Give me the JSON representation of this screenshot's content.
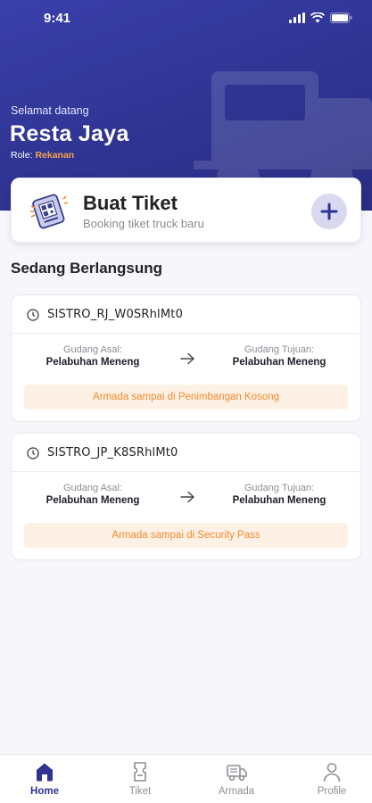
{
  "status_bar": {
    "time": "9:41"
  },
  "header": {
    "welcome": "Selamat datang",
    "user_name": "Resta Jaya",
    "role_label": "Role:",
    "role_value": "Rekanan"
  },
  "create_ticket": {
    "title": "Buat Tiket",
    "subtitle": "Booking tiket truck baru",
    "button_icon": "plus-icon"
  },
  "section": {
    "title": "Sedang Berlangsung"
  },
  "trips": [
    {
      "code": "SISTRO_RJ_W0SRhlMt0",
      "origin_label": "Gudang Asal:",
      "origin_value": "Pelabuhan Meneng",
      "dest_label": "Gudang Tujuan:",
      "dest_value": "Pelabuhan Meneng",
      "status": "Armada sampai di Penimbangan Kosong"
    },
    {
      "code": "SISTRO_JP_K8SRhlMt0",
      "origin_label": "Gudang Asal:",
      "origin_value": "Pelabuhan Meneng",
      "dest_label": "Gudang Tujuan:",
      "dest_value": "Pelabuhan Meneng",
      "status": "Armada sampai di Security Pass"
    }
  ],
  "nav": {
    "items": [
      {
        "label": "Home",
        "icon": "home-icon",
        "active": true
      },
      {
        "label": "Tiket",
        "icon": "ticket-icon",
        "active": false
      },
      {
        "label": "Armada",
        "icon": "truck-icon",
        "active": false
      },
      {
        "label": "Profile",
        "icon": "profile-icon",
        "active": false
      }
    ]
  },
  "colors": {
    "primary": "#2f3492",
    "accent": "#f28a2e",
    "status_bg": "#fdf1e5",
    "background": "#f6f6fb"
  }
}
